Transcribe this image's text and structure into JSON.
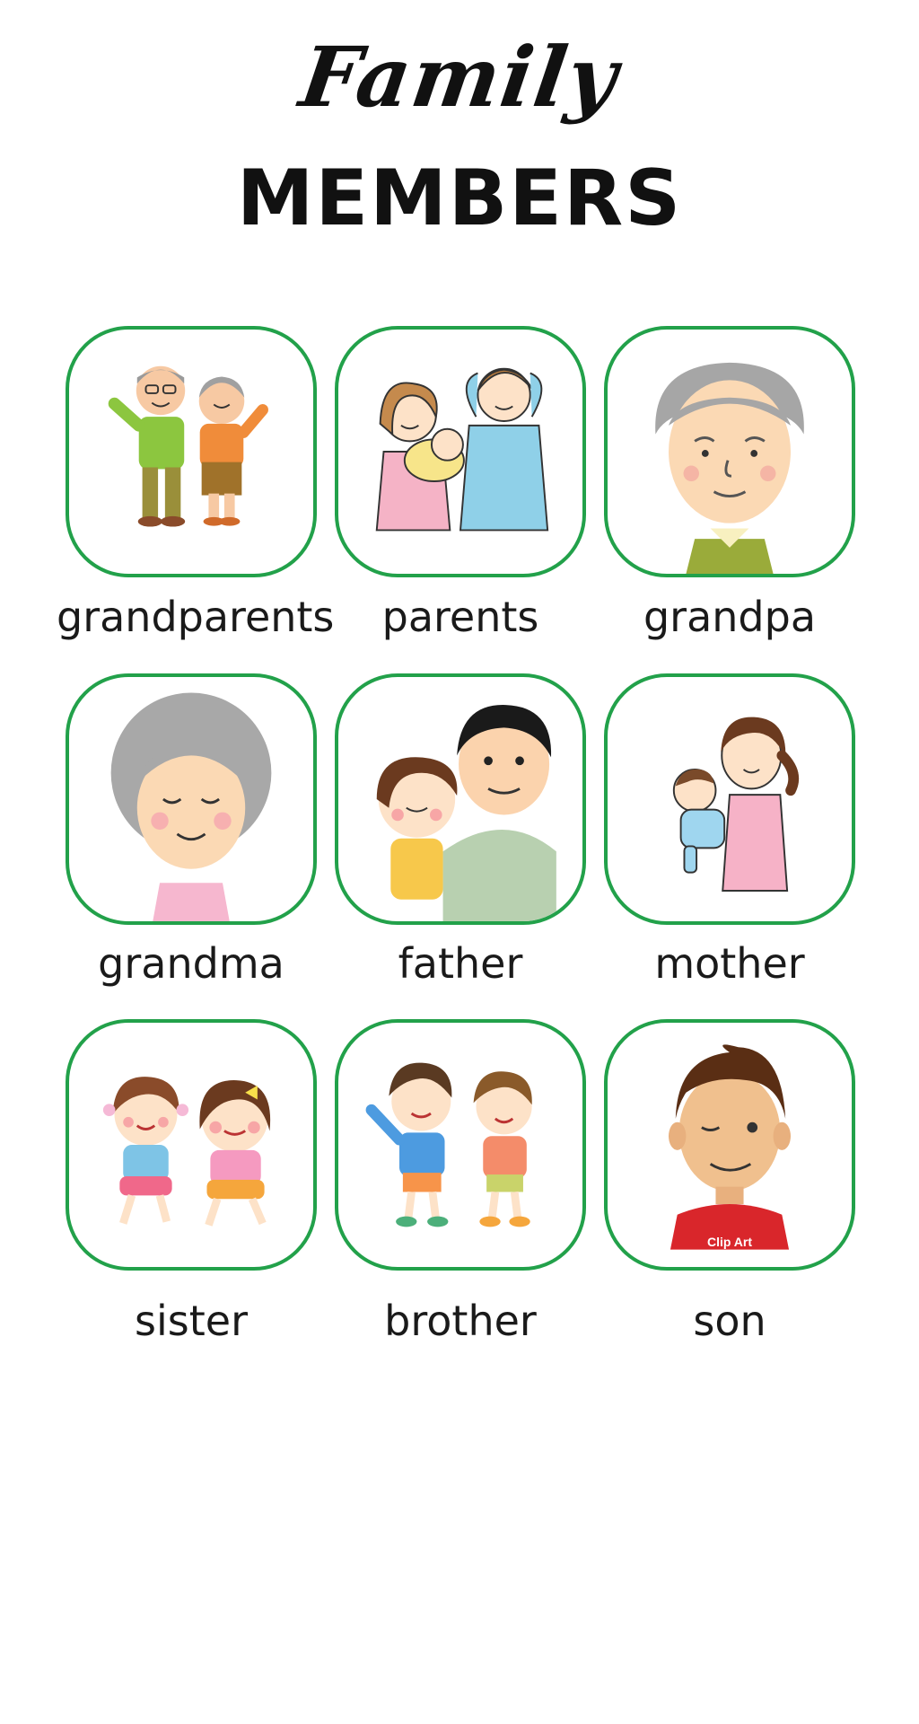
{
  "header": {
    "script_title": "Family",
    "main_title": "MEMBERS"
  },
  "cards": [
    {
      "label": "grandparents",
      "icon": "grandparents-illustration"
    },
    {
      "label": "parents",
      "icon": "parents-illustration"
    },
    {
      "label": "grandpa",
      "icon": "grandpa-illustration"
    },
    {
      "label": "grandma",
      "icon": "grandma-illustration"
    },
    {
      "label": "father",
      "icon": "father-illustration"
    },
    {
      "label": "mother",
      "icon": "mother-illustration"
    },
    {
      "label": "sister",
      "icon": "sister-illustration"
    },
    {
      "label": "brother",
      "icon": "brother-illustration"
    },
    {
      "label": "son",
      "icon": "son-illustration"
    }
  ],
  "watermark": "Clip Art",
  "colors": {
    "card_border": "#22a14a",
    "title": "#111111",
    "label": "#1a1a1a"
  }
}
